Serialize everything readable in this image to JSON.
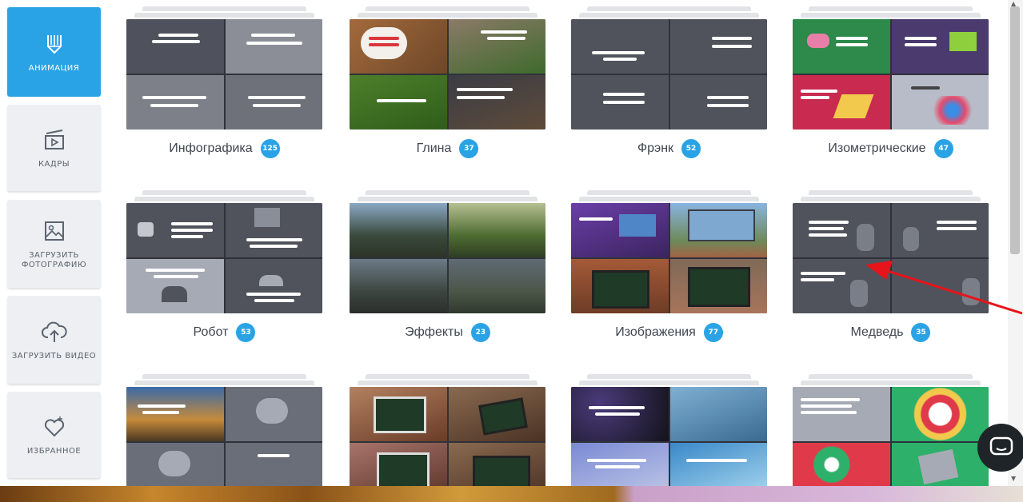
{
  "sidebar": {
    "items": [
      {
        "label": "АНИМАЦИЯ",
        "icon": "animation-pencils-icon",
        "active": true
      },
      {
        "label": "КАДРЫ",
        "icon": "frames-icon",
        "active": false
      },
      {
        "label": "ЗАГРУЗИТЬ ФОТОГРАФИЮ",
        "icon": "upload-photo-icon",
        "active": false
      },
      {
        "label": "ЗАГРУЗИТЬ ВИДЕО",
        "icon": "upload-video-cloud-icon",
        "active": false
      },
      {
        "label": "ИЗБРАННОЕ",
        "icon": "favorites-heart-icon",
        "active": false
      }
    ]
  },
  "categories": [
    {
      "name": "Инфографика",
      "count": "125"
    },
    {
      "name": "Глина",
      "count": "37"
    },
    {
      "name": "Фрэнк",
      "count": "52"
    },
    {
      "name": "Изометрические",
      "count": "47"
    },
    {
      "name": "Робот",
      "count": "53"
    },
    {
      "name": "Эффекты",
      "count": "23"
    },
    {
      "name": "Изображения",
      "count": "77"
    },
    {
      "name": "Медведь",
      "count": "35"
    },
    {
      "name": "",
      "count": ""
    },
    {
      "name": "",
      "count": ""
    },
    {
      "name": "",
      "count": ""
    },
    {
      "name": "",
      "count": ""
    }
  ],
  "colors": {
    "accent": "#2aa3e6",
    "annotation_arrow": "#e8141b"
  }
}
